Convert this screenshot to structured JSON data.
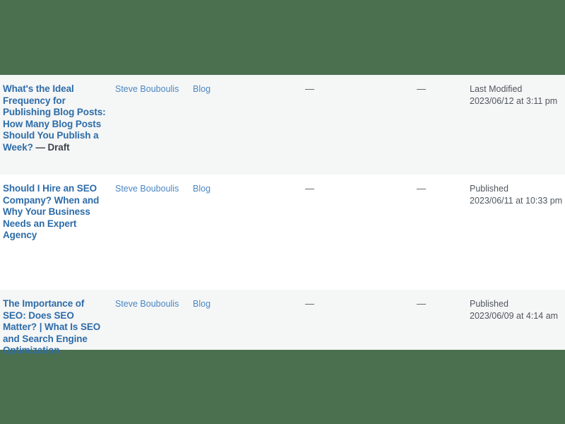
{
  "theme": {
    "page_background": "#4a7050",
    "row_alt_background": "#f5f6f6",
    "row_plain_background": "#ffffff",
    "title_link_color": "#2d6ca8",
    "meta_link_color": "#4a87c4",
    "text_color": "#50575e"
  },
  "table": {
    "rows": [
      {
        "title": "What's the Ideal Frequency for Publishing Blog Posts: How Many Blog Posts Should You Publish a Week?",
        "status_suffix": "— Draft",
        "author": "Steve Bouboulis",
        "categories": "Blog",
        "tags": "—",
        "comments": "—",
        "date_status": "Last Modified",
        "date_value": "2023/06/12 at 3:11 pm"
      },
      {
        "title": "Should I Hire an SEO Company? When and Why Your Business Needs an Expert Agency",
        "status_suffix": "",
        "author": "Steve Bouboulis",
        "categories": "Blog",
        "tags": "—",
        "comments": "—",
        "date_status": "Published",
        "date_value": "2023/06/11 at 10:33 pm"
      },
      {
        "title": "The Importance of SEO: Does SEO Matter? | What Is SEO and Search Engine Optimization",
        "status_suffix": "",
        "author": "Steve Bouboulis",
        "categories": "Blog",
        "tags": "—",
        "comments": "—",
        "date_status": "Published",
        "date_value": "2023/06/09 at 4:14 am"
      }
    ]
  }
}
